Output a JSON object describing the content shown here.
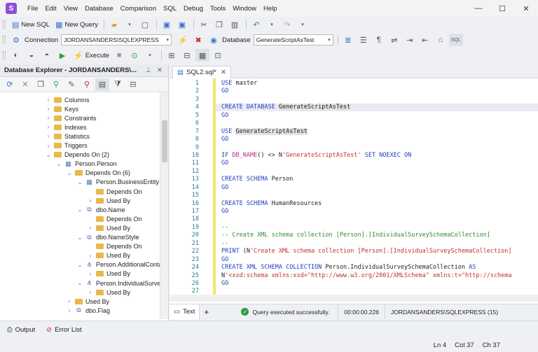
{
  "menu": [
    "File",
    "Edit",
    "View",
    "Database",
    "Comparison",
    "SQL",
    "Debug",
    "Tools",
    "Window",
    "Help"
  ],
  "toolbar1": {
    "new_sql": "New SQL",
    "new_query": "New Query"
  },
  "toolbar2": {
    "connection_label": "Connection",
    "connection_value": "JORDANSANDERS\\SQLEXPRESS",
    "database_label": "Database",
    "database_value": "GenerateScriptAsTest"
  },
  "toolbar3": {
    "execute": "Execute"
  },
  "db_explorer": {
    "title": "Database Explorer - JORDANSANDERS\\...",
    "tree": [
      {
        "label": "Columns",
        "indent": 0,
        "icon": "folder",
        "exp": "collapsed"
      },
      {
        "label": "Keys",
        "indent": 0,
        "icon": "folder",
        "exp": "collapsed"
      },
      {
        "label": "Constraints",
        "indent": 0,
        "icon": "folder",
        "exp": "collapsed"
      },
      {
        "label": "Indexes",
        "indent": 0,
        "icon": "folder",
        "exp": "collapsed"
      },
      {
        "label": "Statistics",
        "indent": 0,
        "icon": "folder",
        "exp": "collapsed"
      },
      {
        "label": "Triggers",
        "indent": 0,
        "icon": "folder",
        "exp": "collapsed"
      },
      {
        "label": "Depends On (2)",
        "indent": 0,
        "icon": "folder",
        "exp": "expanded"
      },
      {
        "label": "Person.Person",
        "indent": 1,
        "icon": "table",
        "exp": "expanded"
      },
      {
        "label": "Depends On (6)",
        "indent": 2,
        "icon": "folder",
        "exp": "expanded"
      },
      {
        "label": "Person.BusinessEntity",
        "indent": 3,
        "icon": "table",
        "exp": "expanded"
      },
      {
        "label": "Depends On",
        "indent": 4,
        "icon": "folder",
        "exp": "none"
      },
      {
        "label": "Used By",
        "indent": 4,
        "icon": "folder",
        "exp": "collapsed"
      },
      {
        "label": "dbo.Name",
        "indent": 3,
        "icon": "type",
        "exp": "expanded"
      },
      {
        "label": "Depends On",
        "indent": 4,
        "icon": "folder",
        "exp": "none"
      },
      {
        "label": "Used By",
        "indent": 4,
        "icon": "folder",
        "exp": "collapsed"
      },
      {
        "label": "dbo.NameStyle",
        "indent": 3,
        "icon": "type",
        "exp": "expanded"
      },
      {
        "label": "Depends On",
        "indent": 4,
        "icon": "folder",
        "exp": "none"
      },
      {
        "label": "Used By",
        "indent": 4,
        "icon": "folder",
        "exp": "collapsed"
      },
      {
        "label": "Person.AdditionalConta",
        "indent": 3,
        "icon": "xml",
        "exp": "expanded"
      },
      {
        "label": "Used By",
        "indent": 4,
        "icon": "folder",
        "exp": "collapsed"
      },
      {
        "label": "Person.IndividualSurvey",
        "indent": 3,
        "icon": "xml",
        "exp": "expanded"
      },
      {
        "label": "Used By",
        "indent": 4,
        "icon": "folder",
        "exp": "collapsed"
      },
      {
        "label": "Used By",
        "indent": 2,
        "icon": "folder",
        "exp": "collapsed"
      },
      {
        "label": "dbo.Flag",
        "indent": 2,
        "icon": "type",
        "exp": "collapsed"
      }
    ]
  },
  "editor": {
    "tab": "SQL2.sql*",
    "current_line": 4,
    "lines": [
      [
        [
          "k",
          "USE"
        ],
        [
          "t",
          " master"
        ]
      ],
      [
        [
          "k",
          "GO"
        ]
      ],
      [],
      [
        [
          "k",
          "CREATE DATABASE"
        ],
        [
          "t",
          " "
        ],
        [
          "h",
          "GenerateScriptAsTest"
        ]
      ],
      [
        [
          "k",
          "GO"
        ]
      ],
      [],
      [
        [
          "k",
          "USE"
        ],
        [
          "t",
          " "
        ],
        [
          "h",
          "GenerateScriptAsTest"
        ]
      ],
      [
        [
          "k",
          "GO"
        ]
      ],
      [],
      [
        [
          "k",
          "IF"
        ],
        [
          "t",
          " "
        ],
        [
          "f",
          "DB_NAME"
        ],
        [
          "t",
          "() <> N"
        ],
        [
          "s",
          "'GenerateScriptAsTest'"
        ],
        [
          "t",
          " "
        ],
        [
          "k",
          "SET NOEXEC ON"
        ]
      ],
      [
        [
          "k",
          "GO"
        ]
      ],
      [],
      [
        [
          "k",
          "CREATE SCHEMA"
        ],
        [
          "t",
          " Person"
        ]
      ],
      [
        [
          "k",
          "GO"
        ]
      ],
      [],
      [
        [
          "k",
          "CREATE SCHEMA"
        ],
        [
          "t",
          " HumanResources"
        ]
      ],
      [
        [
          "k",
          "GO"
        ]
      ],
      [],
      [
        [
          "c",
          "--"
        ]
      ],
      [
        [
          "c",
          "-- Create XML schema collection [Person].[IndividualSurveySchemaCollection]"
        ]
      ],
      [
        [
          "c",
          "--"
        ]
      ],
      [
        [
          "k",
          "PRINT"
        ],
        [
          "t",
          " (N"
        ],
        [
          "s",
          "'Create XML schema collection [Person].[IndividualSurveySchemaCollection]"
        ]
      ],
      [
        [
          "k",
          "GO"
        ]
      ],
      [
        [
          "k",
          "CREATE XML SCHEMA COLLECTION"
        ],
        [
          "t",
          " Person.IndividualSurveySchemaCollection "
        ],
        [
          "k",
          "AS"
        ]
      ],
      [
        [
          "t",
          "N"
        ],
        [
          "s",
          "'<xsd:schema xmlns:xsd=\"http://www.w3.org/2001/XMLSchema\" xmlns:t=\"http://schema"
        ]
      ],
      [
        [
          "k",
          "GO"
        ]
      ],
      []
    ]
  },
  "status": {
    "text_tab": "Text",
    "message": "Query executed successfully.",
    "time": "00:00:00.226",
    "connection": "JORDANSANDERS\\SQLEXPRESS (15)"
  },
  "bottom": {
    "output": "Output",
    "error_list": "Error List"
  },
  "footer": {
    "ln": "Ln 4",
    "col": "Col 37",
    "ch": "Ch 37"
  },
  "colors": {
    "accent": "#8b4fd8",
    "keyword": "#1f3fbf",
    "string": "#c03030",
    "comment": "#2f8a2f",
    "success": "#2e9b46"
  }
}
